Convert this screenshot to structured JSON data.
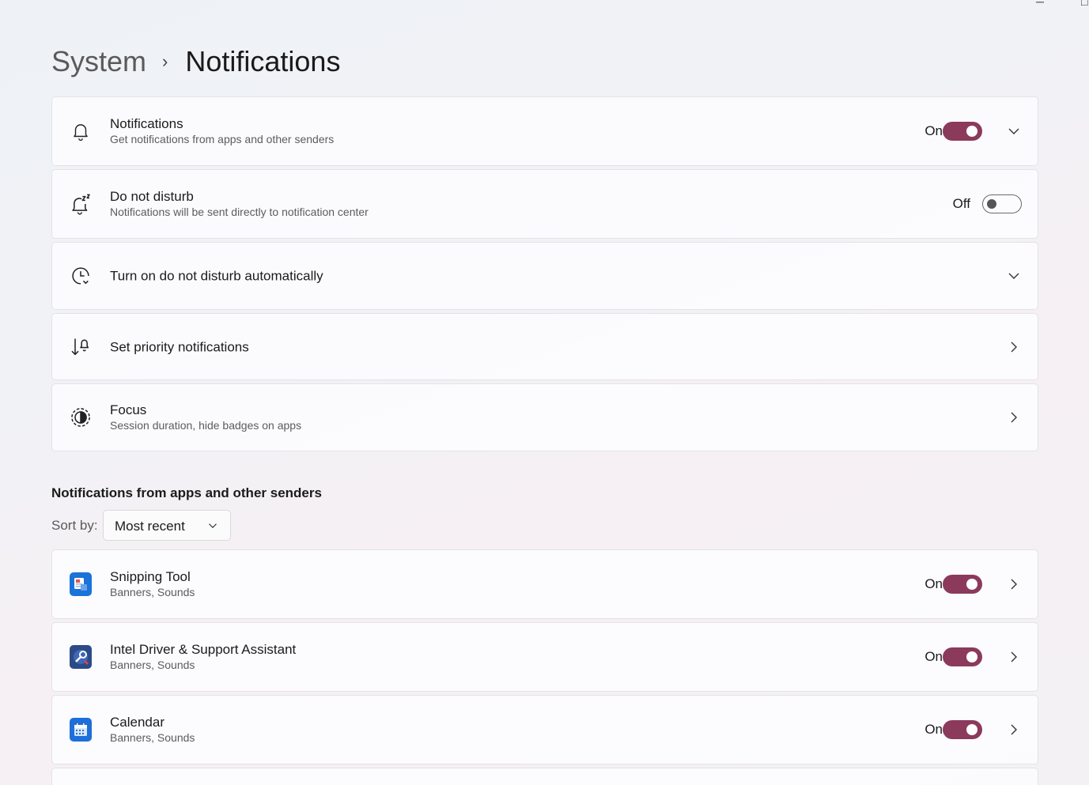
{
  "window": {
    "minimize_glyph": "─",
    "maximize_glyph": "□"
  },
  "breadcrumb": {
    "parent": "System",
    "separator": "›",
    "current": "Notifications"
  },
  "settings": [
    {
      "title": "Notifications",
      "subtitle": "Get notifications from apps and other senders",
      "state": "On",
      "icon": "bell-icon",
      "action": "chevron-down-icon"
    },
    {
      "title": "Do not disturb",
      "subtitle": "Notifications will be sent directly to notification center",
      "state": "Off",
      "icon": "bell-snooze-icon"
    },
    {
      "title": "Turn on do not disturb automatically",
      "icon": "clock-icon",
      "action": "chevron-down-icon"
    },
    {
      "title": "Set priority notifications",
      "icon": "priority-icon",
      "action": "chevron-right-icon"
    },
    {
      "title": "Focus",
      "subtitle": "Session duration, hide badges on apps",
      "icon": "focus-icon",
      "action": "chevron-right-icon"
    }
  ],
  "apps_section": {
    "title": "Notifications from apps and other senders",
    "sort_label": "Sort by:",
    "sort_value": "Most recent"
  },
  "apps": [
    {
      "name": "Snipping Tool",
      "detail": "Banners, Sounds",
      "state": "On",
      "icon": "snipping-tool-icon"
    },
    {
      "name": "Intel Driver & Support Assistant",
      "detail": "Banners, Sounds",
      "state": "On",
      "icon": "intel-dsa-icon"
    },
    {
      "name": "Calendar",
      "detail": "Banners, Sounds",
      "state": "On",
      "icon": "calendar-icon"
    }
  ],
  "colors": {
    "accent": "#8b3a5b",
    "snipping": "#1a73d9",
    "intel": "#2c4a86",
    "calendar": "#1e6fd9"
  }
}
